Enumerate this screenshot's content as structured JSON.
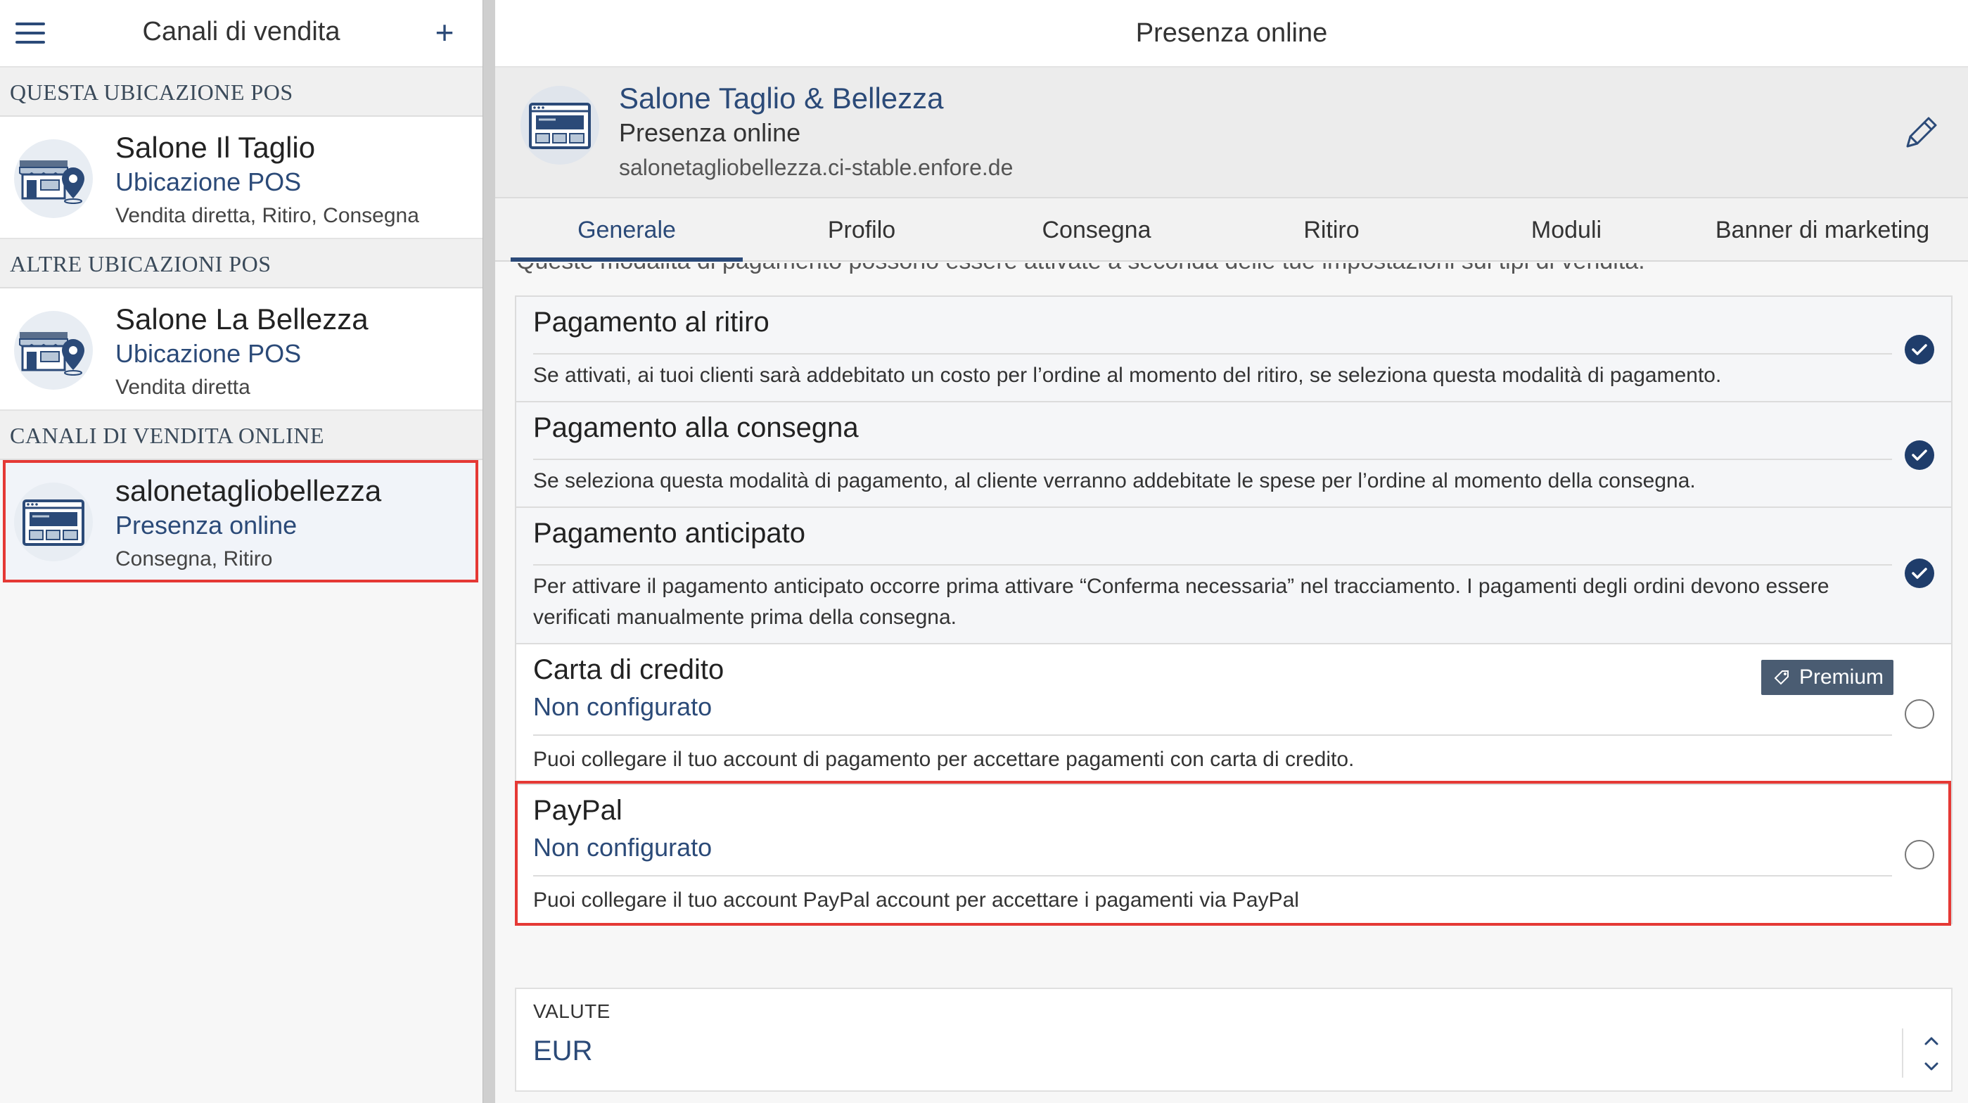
{
  "sidebar": {
    "title": "Canali di vendita",
    "sections": {
      "this_location": "QUESTA UBICAZIONE POS",
      "other_locations": "ALTRE UBICAZIONI POS",
      "online_channels": "CANALI DI VENDITA ONLINE"
    },
    "items": [
      {
        "name": "Salone Il Taglio",
        "type": "Ubicazione POS",
        "modes": "Vendita diretta, Ritiro, Consegna"
      },
      {
        "name": "Salone La Bellezza",
        "type": "Ubicazione POS",
        "modes": "Vendita diretta"
      },
      {
        "name": "salonetagliobellezza",
        "type": "Presenza online",
        "modes": "Consegna, Ritiro"
      }
    ]
  },
  "main": {
    "header_title": "Presenza online",
    "channel": {
      "name": "Salone Taglio & Bellezza",
      "type": "Presenza online",
      "url": "salonetagliobellezza.ci-stable.enfore.de"
    },
    "tabs": [
      {
        "label": "Generale"
      },
      {
        "label": "Profilo"
      },
      {
        "label": "Consegna"
      },
      {
        "label": "Ritiro"
      },
      {
        "label": "Moduli"
      },
      {
        "label": "Banner di marketing"
      }
    ],
    "intro_text": "Queste modalità di pagamento possono essere attivate a seconda delle tue impostazioni sui tipi di vendita.",
    "payments": [
      {
        "title": "Pagamento al ritiro",
        "description": "Se attivati, ai tuoi clienti sarà addebitato un costo per l’ordine al momento del ritiro, se seleziona questa modalità di pagamento.",
        "enabled": true
      },
      {
        "title": "Pagamento alla consegna",
        "description": "Se seleziona questa modalità di pagamento, al cliente verranno addebitate le spese per l’ordine al momento della consegna.",
        "enabled": true
      },
      {
        "title": "Pagamento anticipato",
        "description": "Per attivare il pagamento anticipato occorre prima attivare “Conferma necessaria” nel tracciamento. I pagamenti degli ordini devono essere verificati manualmente prima della consegna.",
        "enabled": true
      },
      {
        "title": "Carta di credito",
        "status": "Non configurato",
        "badge": "Premium",
        "description": "Puoi collegare il tuo account di pagamento per accettare pagamenti con carta di credito.",
        "enabled": false
      },
      {
        "title": "PayPal",
        "status": "Non configurato",
        "description": "Puoi collegare il tuo account PayPal account per accettare i pagamenti via PayPal",
        "enabled": false
      }
    ],
    "currency": {
      "label": "VALUTE",
      "value": "EUR"
    }
  },
  "colors": {
    "accent": "#2b4a78",
    "highlight": "#e53935",
    "badge": "#4a5c72"
  }
}
